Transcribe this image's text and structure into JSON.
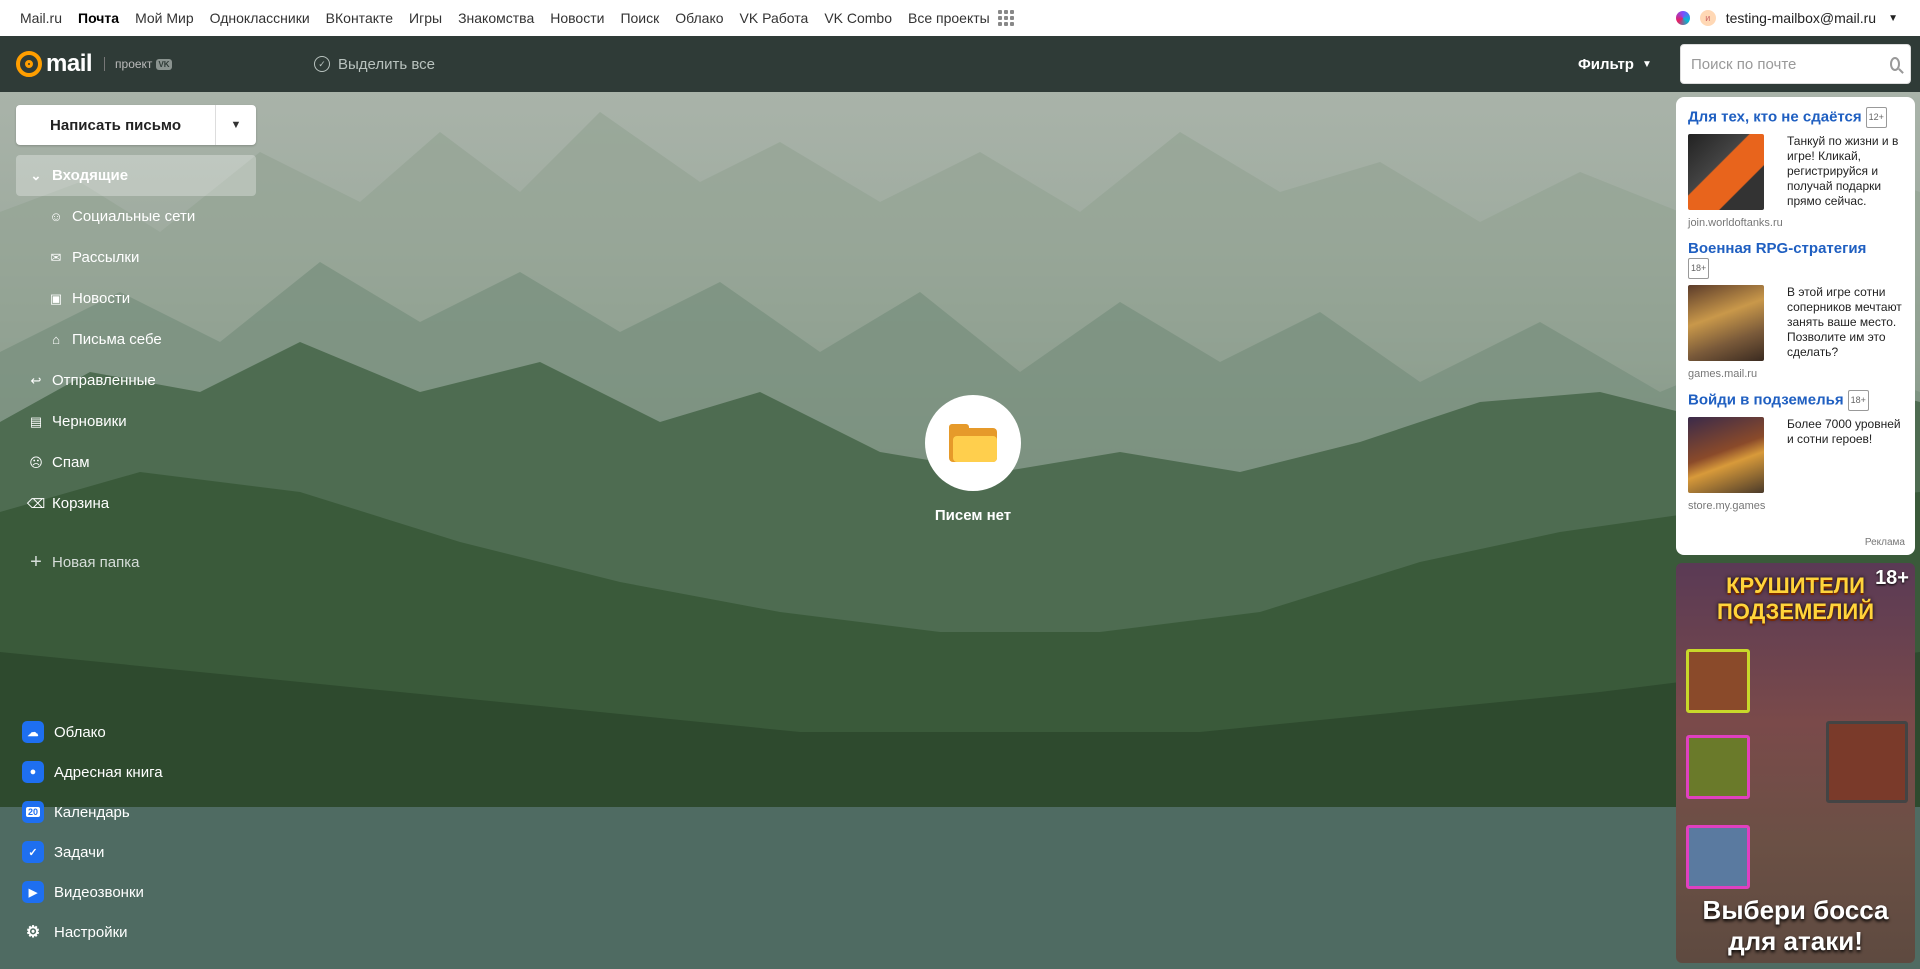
{
  "portal": {
    "links": [
      "Mail.ru",
      "Почта",
      "Мой Мир",
      "Одноклассники",
      "ВКонтакте",
      "Игры",
      "Знакомства",
      "Новости",
      "Поиск",
      "Облако",
      "VK Работа",
      "VK Combo",
      "Все проекты"
    ],
    "active_link": "Почта",
    "account_email": "testing-mailbox@mail.ru"
  },
  "header": {
    "logo_text": "mail",
    "project_text": "проект",
    "vk_badge": "VK",
    "select_all": "Выделить все",
    "filter": "Фильтр",
    "search_placeholder": "Поиск по почте"
  },
  "sidebar": {
    "compose": "Написать письмо",
    "folders": [
      {
        "label": "Входящие",
        "icon": "chevron-down-icon",
        "active": true
      },
      {
        "label": "Социальные сети",
        "icon": "social-icon"
      },
      {
        "label": "Рассылки",
        "icon": "newsletter-icon"
      },
      {
        "label": "Новости",
        "icon": "news-icon"
      },
      {
        "label": "Письма себе",
        "icon": "to-self-icon"
      },
      {
        "label": "Отправленные",
        "icon": "sent-icon"
      },
      {
        "label": "Черновики",
        "icon": "drafts-icon"
      },
      {
        "label": "Спам",
        "icon": "spam-icon"
      },
      {
        "label": "Корзина",
        "icon": "trash-icon"
      }
    ],
    "new_folder": "Новая папка",
    "apps": [
      {
        "label": "Облако",
        "icon": "cloud-icon",
        "color": "#1e6ff0"
      },
      {
        "label": "Адресная книга",
        "icon": "contacts-icon",
        "color": "#1e6ff0"
      },
      {
        "label": "Календарь",
        "icon": "calendar-icon",
        "color": "#1e6ff0",
        "badge": "20"
      },
      {
        "label": "Задачи",
        "icon": "tasks-icon",
        "color": "#1e6ff0"
      },
      {
        "label": "Видеозвонки",
        "icon": "video-call-icon",
        "color": "#1e6ff0"
      },
      {
        "label": "Настройки",
        "icon": "settings-icon",
        "color": "transparent"
      }
    ]
  },
  "main": {
    "empty_text": "Писем нет"
  },
  "ads": {
    "items": [
      {
        "title": "Для тех, кто не сдаётся",
        "age": "12+",
        "text": "Танкуй по жизни и в игре! Кликай, регистрируйся и получай подарки прямо сейчас.",
        "domain": "join.worldoftanks.ru"
      },
      {
        "title": "Военная RPG-стратегия",
        "age": "18+",
        "text": "В этой игре сотни соперников мечтают занять ваше место. Позволите им это сделать?",
        "domain": "games.mail.ru"
      },
      {
        "title": "Войди в подземелья",
        "age": "18+",
        "text": "Более 7000 уровней и сотни героев!",
        "domain": "store.my.games"
      }
    ],
    "label": "Реклама",
    "banner": {
      "title": "КРУШИТЕЛИ ПОДЗЕМЕЛИЙ",
      "age": "18+",
      "cta": "Выбери босса для атаки!"
    }
  },
  "colors": {
    "header_bg": "#2f3b37",
    "link_blue": "#1f5fc1",
    "logo_orange": "#ff9e00"
  }
}
